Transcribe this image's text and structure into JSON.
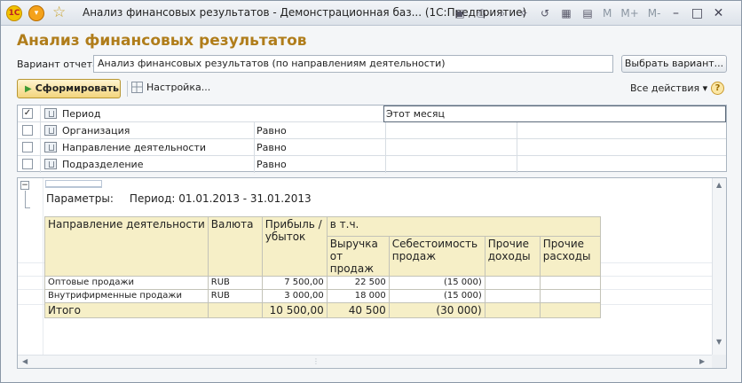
{
  "window": {
    "title": "Анализ финансовых результатов - Демонстрационная баз... (1С:Предприятие)",
    "logo_text": "1С",
    "toolbar_m_labels": [
      "M",
      "M+",
      "M-"
    ],
    "controls": [
      "–",
      "□",
      "✕"
    ]
  },
  "page": {
    "title": "Анализ финансовых результатов",
    "variant_label": "Вариант отчета:",
    "variant_value": "Анализ финансовых результатов (по направлениям деятельности)",
    "choose_variant": "Выбрать вариант...",
    "run_button": "Сформировать",
    "settings_label": "Настройка...",
    "all_actions": "Все действия",
    "help": "?"
  },
  "filters": [
    {
      "checked": true,
      "name": "Период",
      "comparison": "",
      "value": "Этот месяц"
    },
    {
      "checked": false,
      "name": "Организация",
      "comparison": "Равно",
      "value": ""
    },
    {
      "checked": false,
      "name": "Направление деятельности",
      "comparison": "Равно",
      "value": ""
    },
    {
      "checked": false,
      "name": "Подразделение",
      "comparison": "Равно",
      "value": ""
    }
  ],
  "report": {
    "params_label": "Параметры:",
    "params_value": "Период: 01.01.2013 - 31.01.2013",
    "headers": {
      "direction": "Направление деятельности",
      "currency": "Валюта",
      "profit": "Прибыль / убыток",
      "incl": "в т.ч.",
      "revenue": "Выручка от продаж",
      "cost": "Себестоимость продаж",
      "other_income": "Прочие доходы",
      "other_expenses": "Прочие расходы"
    },
    "rows": [
      {
        "direction": "Оптовые продажи",
        "currency": "RUB",
        "profit": "7 500,00",
        "revenue": "22 500",
        "cost": "(15 000)",
        "other_income": "",
        "other_expenses": ""
      },
      {
        "direction": "Внутрифирменные продажи",
        "currency": "RUB",
        "profit": "3 000,00",
        "revenue": "18 000",
        "cost": "(15 000)",
        "other_income": "",
        "other_expenses": ""
      }
    ],
    "total": {
      "label": "Итого",
      "profit": "10 500,00",
      "revenue": "40 500",
      "cost": "(30 000)"
    }
  }
}
